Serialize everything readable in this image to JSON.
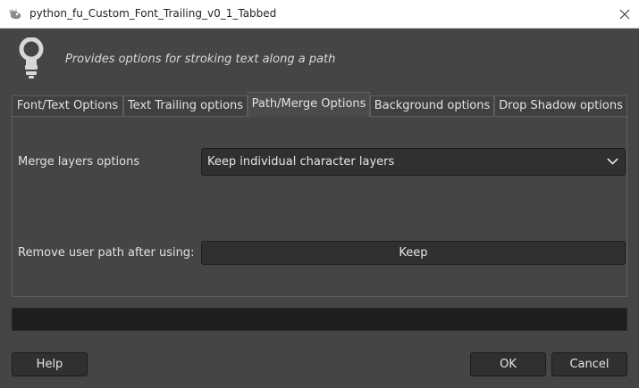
{
  "window": {
    "title": "python_fu_Custom_Font_Trailing_v0_1_Tabbed",
    "app_icon": "gimp-wilber-icon",
    "close_icon": "close-icon"
  },
  "header": {
    "icon": "lightbulb-icon",
    "description": "Provides options for stroking text along a path"
  },
  "tabs": [
    {
      "label": "Font/Text Options",
      "active": false
    },
    {
      "label": "Text Trailing options",
      "active": false
    },
    {
      "label": "Path/Merge Options",
      "active": true
    },
    {
      "label": "Background options",
      "active": false
    },
    {
      "label": "Drop Shadow options",
      "active": false
    }
  ],
  "panel": {
    "merge_label": "Merge layers options",
    "merge_value": "Keep individual character layers",
    "remove_path_label": "Remove user path after using:",
    "remove_path_value": "Keep"
  },
  "progress": {
    "value": 0
  },
  "buttons": {
    "help": "Help",
    "ok": "OK",
    "cancel": "Cancel"
  },
  "colors": {
    "background": "#454545",
    "field": "#303030",
    "progress_trough": "#1e1e1e"
  }
}
